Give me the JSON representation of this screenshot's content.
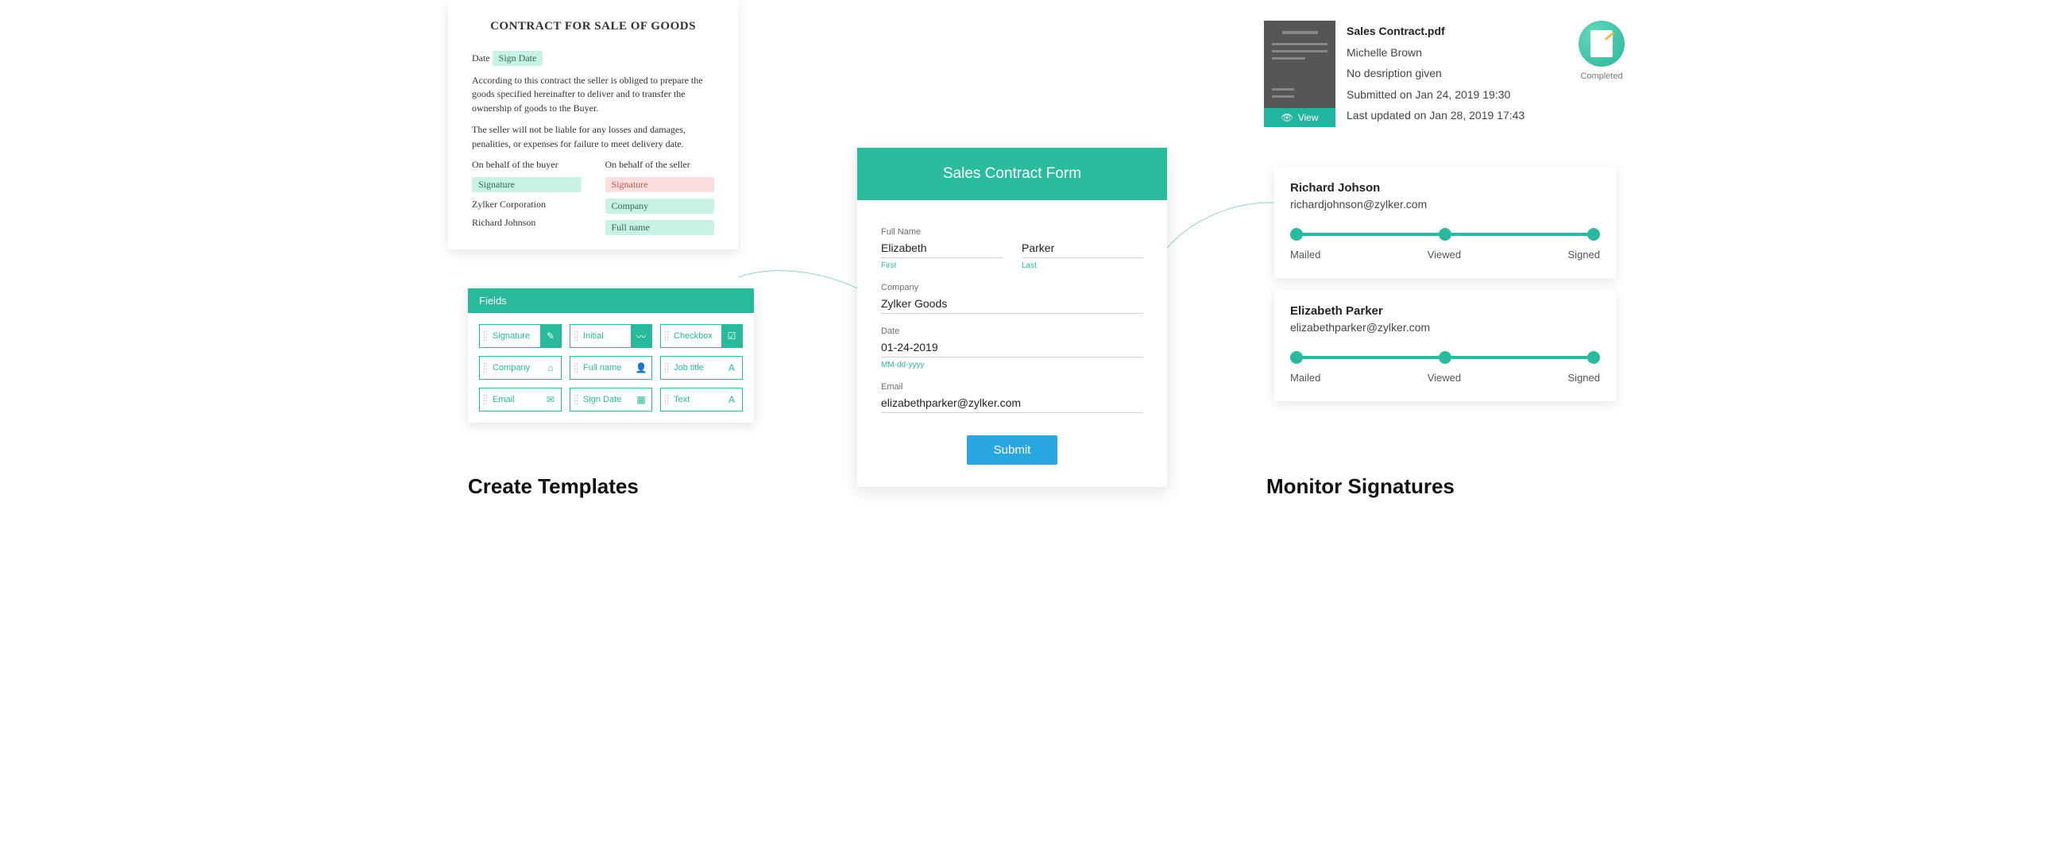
{
  "template": {
    "title": "CONTRACT FOR SALE OF GOODS",
    "date_label": "Date",
    "sign_date_tag": "Sign Date",
    "paragraph1": "According to this contract the seller is obliged to prepare the goods specified hereinafter to deliver and to transfer the ownership of goods to the Buyer.",
    "paragraph2": "The seller will not be liable for any losses and damages, penalities, or expenses for failure to meet delivery date.",
    "buyer_heading": "On behalf of the buyer",
    "seller_heading": "On behalf of the seller",
    "signature_tag": "Signature",
    "buyer_company": "Zylker Corporation",
    "buyer_name": "Richard Johnson",
    "company_tag": "Company",
    "fullname_tag": "Full name"
  },
  "fields": {
    "header": "Fields",
    "items": [
      {
        "label": "Signature",
        "icon": "✎",
        "style": "filled"
      },
      {
        "label": "Initial",
        "icon": "〰",
        "style": "filled"
      },
      {
        "label": "Checkbox",
        "icon": "☑",
        "style": "filled"
      },
      {
        "label": "Company",
        "icon": "⌂",
        "style": "outline"
      },
      {
        "label": "Full name",
        "icon": "👤",
        "style": "outline"
      },
      {
        "label": "Job title",
        "icon": "A",
        "style": "outline"
      },
      {
        "label": "Email",
        "icon": "✉",
        "style": "outline"
      },
      {
        "label": "Sign Date",
        "icon": "▦",
        "style": "outline"
      },
      {
        "label": "Text",
        "icon": "A",
        "style": "outline"
      }
    ]
  },
  "captions": {
    "left": "Create Templates",
    "right": "Monitor Signatures"
  },
  "form": {
    "title": "Sales Contract Form",
    "full_name_label": "Full Name",
    "first_value": "Elizabeth",
    "first_hint": "First",
    "last_value": "Parker",
    "last_hint": "Last",
    "company_label": "Company",
    "company_value": "Zylker Goods",
    "date_label": "Date",
    "date_value": "01-24-2019",
    "date_hint": "MM-dd-yyyy",
    "email_label": "Email",
    "email_value": "elizabethparker@zylker.com",
    "submit": "Submit"
  },
  "monitor": {
    "file": "Sales Contract.pdf",
    "owner": "Michelle Brown",
    "desc": "No desription given",
    "submitted": "Submitted on Jan 24, 2019 19:30",
    "updated": "Last updated on Jan 28, 2019 17:43",
    "view": "View",
    "status": "Completed",
    "steps": {
      "mailed": "Mailed",
      "viewed": "Viewed",
      "signed": "Signed"
    },
    "signers": [
      {
        "name": "Richard Johson",
        "email": "richardjohnson@zylker.com"
      },
      {
        "name": "Elizabeth Parker",
        "email": "elizabethparker@zylker.com"
      }
    ]
  }
}
